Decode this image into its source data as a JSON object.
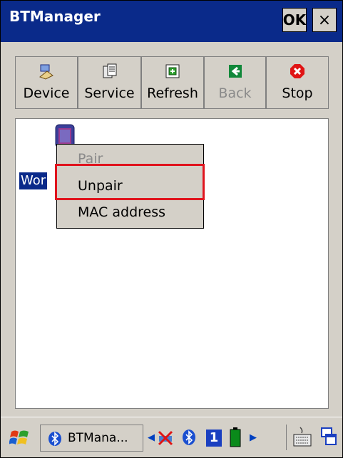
{
  "window": {
    "title": "BTManager",
    "ok_label": "OK",
    "close_label": "×"
  },
  "toolbar": {
    "buttons": [
      {
        "label": "Device",
        "icon": "device-icon",
        "enabled": true
      },
      {
        "label": "Service",
        "icon": "service-icon",
        "enabled": true
      },
      {
        "label": "Refresh",
        "icon": "refresh-icon",
        "enabled": true
      },
      {
        "label": "Back",
        "icon": "back-arrow-icon",
        "enabled": false
      },
      {
        "label": "Stop",
        "icon": "stop-icon",
        "enabled": true
      }
    ]
  },
  "content": {
    "device": {
      "label": "Wor",
      "icon": "bluetooth-device-icon"
    }
  },
  "context_menu": {
    "items": [
      {
        "label": "Pair",
        "enabled": false
      },
      {
        "label": "Unpair",
        "enabled": true
      },
      {
        "label": "MAC address",
        "enabled": true
      }
    ],
    "highlighted": "Unpair",
    "highlight_color": "#e0141e"
  },
  "taskbar": {
    "start_icon": "windows-flag-icon",
    "task": {
      "label": "BTMana...",
      "icon": "bluetooth-icon"
    },
    "tray": {
      "network_icon": "network-disconnected-icon",
      "bluetooth_icon": "bluetooth-icon",
      "number": "1",
      "battery_icon": "battery-icon"
    },
    "keyboard_icon": "keyboard-icon",
    "switcher_icon": "window-switch-icon"
  },
  "colors": {
    "title_bar": "#0a2a8a",
    "selection": "#0a2a8a",
    "background": "#d4d0c8"
  }
}
